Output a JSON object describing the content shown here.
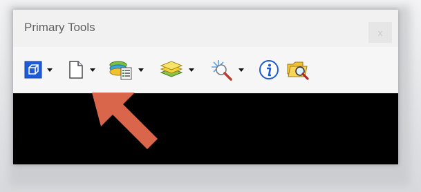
{
  "window": {
    "title": "Primary Tools",
    "close_label": "x"
  },
  "toolbar": {
    "tools": [
      {
        "name": "element-selection",
        "icon": "cube-icon",
        "has_dropdown": true
      },
      {
        "name": "attributes",
        "icon": "document-icon",
        "has_dropdown": true
      },
      {
        "name": "level-display",
        "icon": "layered-list-icon",
        "has_dropdown": true
      },
      {
        "name": "levels",
        "icon": "stacked-layers-icon",
        "has_dropdown": true
      },
      {
        "name": "analyze",
        "icon": "sparkle-magnifier-icon",
        "has_dropdown": true
      },
      {
        "name": "element-information",
        "icon": "info-icon",
        "has_dropdown": false
      },
      {
        "name": "find",
        "icon": "folder-search-icon",
        "has_dropdown": false
      }
    ]
  },
  "annotation": {
    "arrow_color": "#d9664a",
    "points_to": "attributes"
  }
}
